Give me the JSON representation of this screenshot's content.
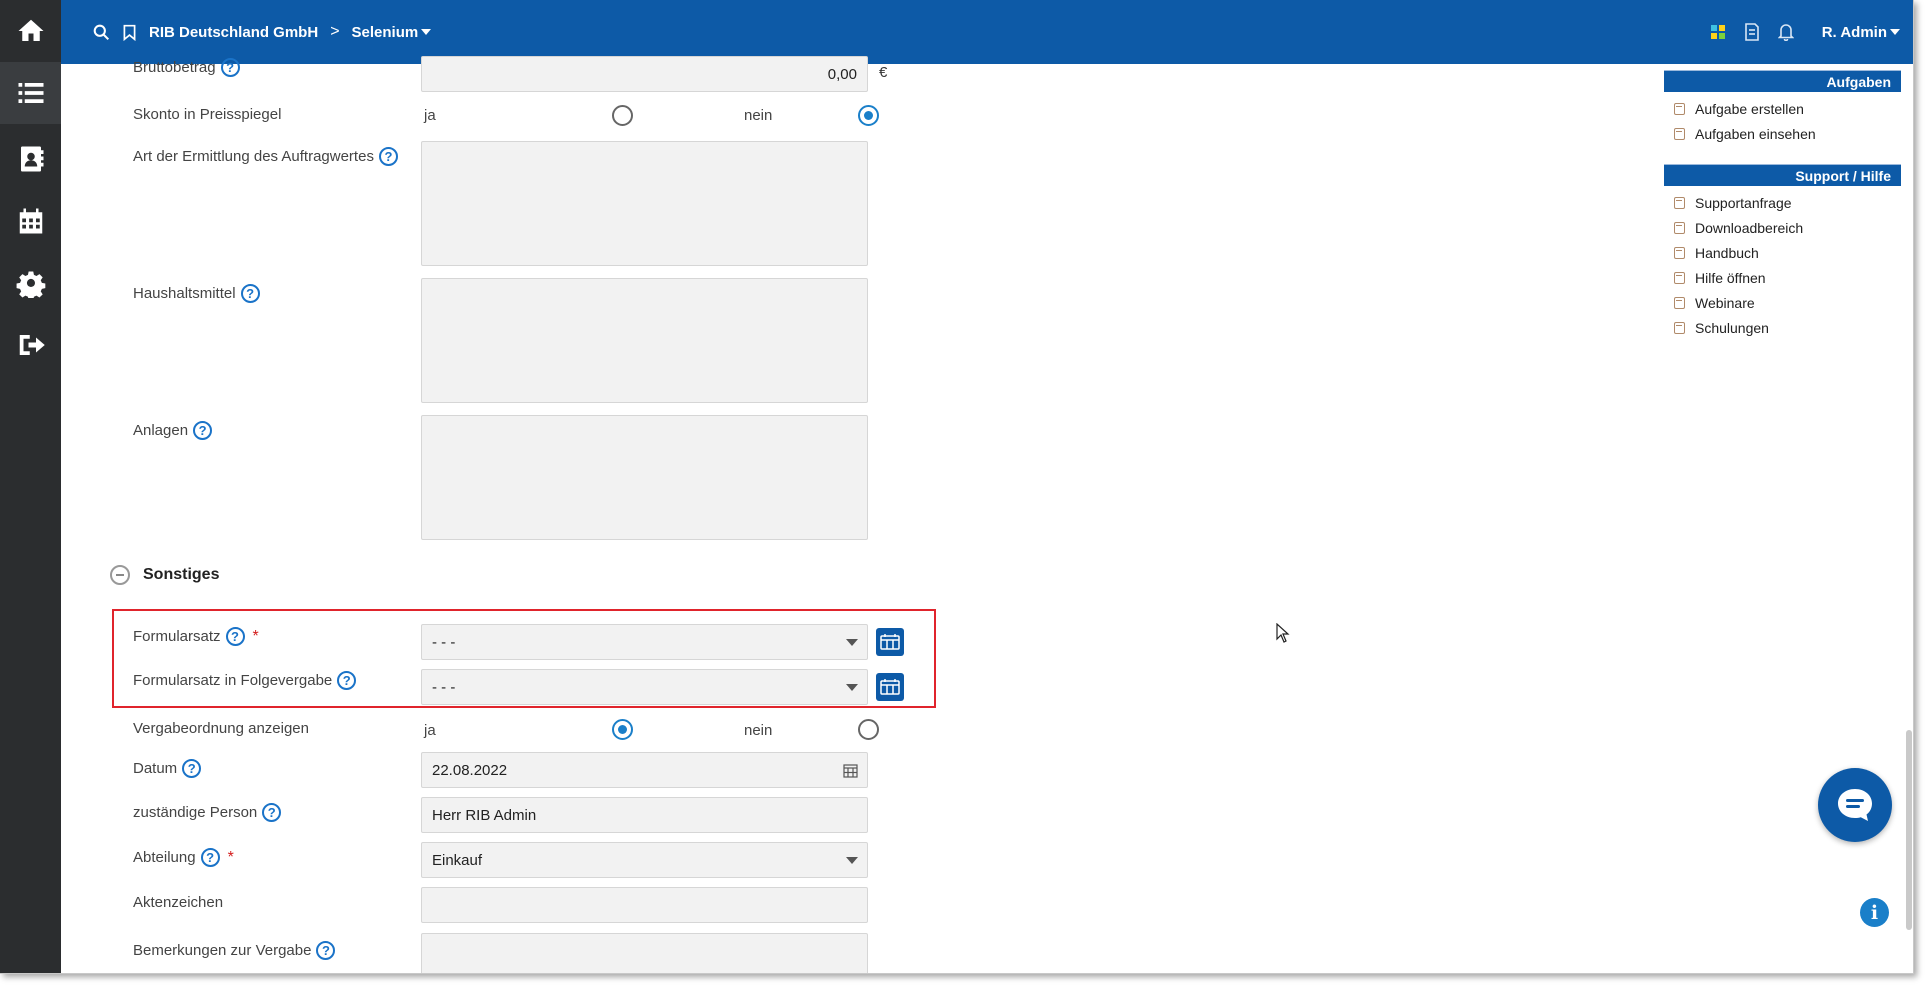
{
  "topbar": {
    "company": "RIB Deutschland GmbH",
    "separator": ">",
    "project": "Selenium",
    "user": "R. Admin"
  },
  "form": {
    "brutto_label": "Bruttobetrag",
    "brutto_value": "0,00",
    "currency": "€",
    "skonto_label": "Skonto in Preisspiegel",
    "skonto_yes": "ja",
    "skonto_no": "nein",
    "skonto_selected": "nein",
    "ermittlung_label": "Art der Ermittlung des Auftragwertes",
    "haushalt_label": "Haushaltsmittel",
    "anlagen_label": "Anlagen",
    "section_title": "Sonstiges",
    "formularsatz_label": "Formularsatz",
    "formularsatz_value": "- - -",
    "folge_label": "Formularsatz in Folgevergabe",
    "folge_value": "- - -",
    "vergabe_label": "Vergabeordnung anzeigen",
    "vergabe_yes": "ja",
    "vergabe_no": "nein",
    "vergabe_selected": "ja",
    "datum_label": "Datum",
    "datum_value": "22.08.2022",
    "person_label": "zuständige Person",
    "person_value": "Herr RIB Admin",
    "abteilung_label": "Abteilung",
    "abteilung_value": "Einkauf",
    "akten_label": "Aktenzeichen",
    "akten_value": "",
    "bemerk_label": "Bemerkungen zur Vergabe",
    "required_mark": "*",
    "help_glyph": "?"
  },
  "sidebar": {
    "aufgaben_title": "Aufgaben",
    "aufgaben_items": [
      "Aufgabe erstellen",
      "Aufgaben einsehen"
    ],
    "support_title": "Support / Hilfe",
    "support_items": [
      "Supportanfrage",
      "Downloadbereich",
      "Handbuch",
      "Hilfe öffnen",
      "Webinare",
      "Schulungen"
    ]
  },
  "floating": {
    "info_glyph": "i"
  },
  "colors": {
    "brand_blue": "#0d5aa7",
    "rail_dark": "#2b2d2f",
    "highlight_red": "#e0242c",
    "help_blue": "#1a73c8"
  },
  "icons": {
    "rail": [
      "home-icon",
      "list-icon",
      "contacts-icon",
      "calendar-icon",
      "settings-icon",
      "logout-icon"
    ],
    "topbar": [
      "search-icon",
      "bookmark-icon",
      "apps-icon",
      "document-icon",
      "bell-icon"
    ]
  }
}
